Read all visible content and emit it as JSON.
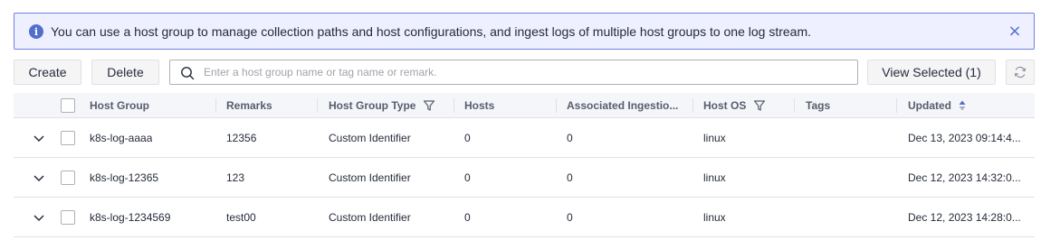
{
  "notice": {
    "icon": "info-icon",
    "text": "You can use a host group to manage collection paths and host configurations, and ingest logs of multiple host groups to one log stream.",
    "close_icon": "close-icon",
    "accent": "#526ecc"
  },
  "toolbar": {
    "create_label": "Create",
    "delete_label": "Delete",
    "search_placeholder": "Enter a host group name or tag name or remark.",
    "search_value": "",
    "view_selected_label": "View Selected (1)",
    "refresh_icon": "refresh-icon"
  },
  "table": {
    "columns": {
      "host_group": "Host Group",
      "remarks": "Remarks",
      "host_group_type": "Host Group Type",
      "hosts": "Hosts",
      "associated_ingestion": "Associated Ingestio...",
      "host_os": "Host OS",
      "tags": "Tags",
      "updated": "Updated"
    },
    "rows": [
      {
        "host_group": "k8s-log-aaaa",
        "remarks": "12356",
        "host_group_type": "Custom Identifier",
        "hosts": "0",
        "associated_ingestion": "0",
        "host_os": "linux",
        "tags": "",
        "updated": "Dec 13, 2023 09:14:4..."
      },
      {
        "host_group": "k8s-log-12365",
        "remarks": "123",
        "host_group_type": "Custom Identifier",
        "hosts": "0",
        "associated_ingestion": "0",
        "host_os": "linux",
        "tags": "",
        "updated": "Dec 12, 2023 14:32:0..."
      },
      {
        "host_group": "k8s-log-1234569",
        "remarks": "test00",
        "host_group_type": "Custom Identifier",
        "hosts": "0",
        "associated_ingestion": "0",
        "host_os": "linux",
        "tags": "",
        "updated": "Dec 12, 2023 14:28:0..."
      }
    ]
  }
}
